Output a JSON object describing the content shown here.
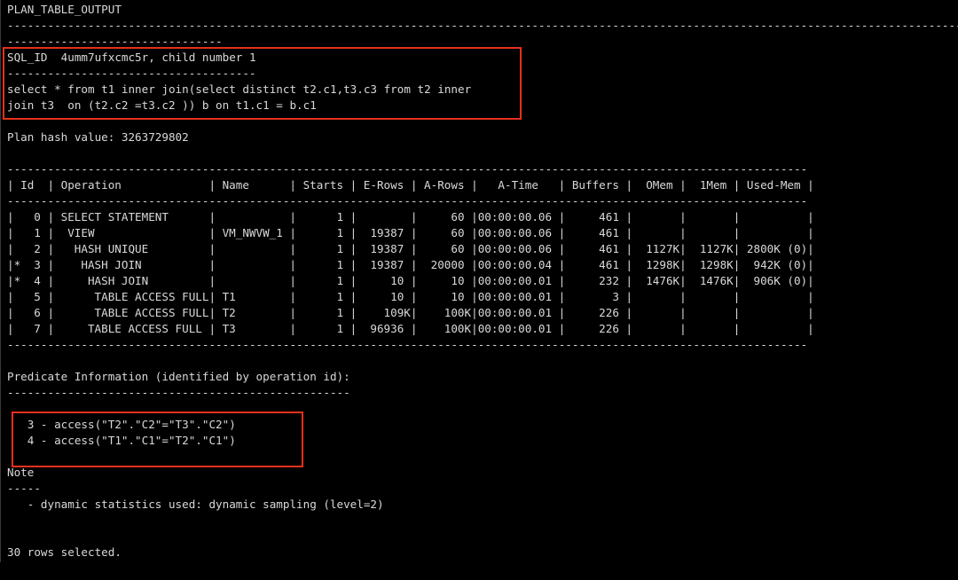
{
  "header_title": "PLAN_TABLE_OUTPUT",
  "separators": {
    "top_long": "----------------------------------------------------------------------------------------------------------------------------------------------",
    "top_short": "--------------------------------",
    "sql_id_under": "-------------------------------------",
    "table": "-----------------------------------------------------------------------------------------------------------------------",
    "predicate_under": "---------------------------------------------------",
    "note_under": "-----"
  },
  "sql": {
    "sql_id_line": "SQL_ID  4umm7ufxcmc5r, child number 1",
    "query_lines": [
      "select * from t1 inner join(select distinct t2.c1,t3.c3 from t2 inner",
      "join t3  on (t2.c2 =t3.c2 )) b on t1.c1 = b.c1"
    ]
  },
  "plan_hash": "Plan hash value: 3263729802",
  "table": {
    "columns": [
      "Id",
      "Operation",
      "Name",
      "Starts",
      "E-Rows",
      "A-Rows",
      "A-Time",
      "Buffers",
      "OMem",
      "1Mem",
      "Used-Mem"
    ],
    "rows": [
      {
        "flag": "",
        "id": "0",
        "depth": 0,
        "operation": "SELECT STATEMENT",
        "name": "",
        "starts": "1",
        "e_rows": "",
        "a_rows": "60",
        "a_time": "00:00:00.06",
        "buffers": "461",
        "omem": "",
        "onemem": "",
        "used_mem": ""
      },
      {
        "flag": "",
        "id": "1",
        "depth": 1,
        "operation": "VIEW",
        "name": "VM_NWVW_1",
        "starts": "1",
        "e_rows": "19387",
        "a_rows": "60",
        "a_time": "00:00:00.06",
        "buffers": "461",
        "omem": "",
        "onemem": "",
        "used_mem": ""
      },
      {
        "flag": "",
        "id": "2",
        "depth": 2,
        "operation": "HASH UNIQUE",
        "name": "",
        "starts": "1",
        "e_rows": "19387",
        "a_rows": "60",
        "a_time": "00:00:00.06",
        "buffers": "461",
        "omem": "1127K",
        "onemem": "1127K",
        "used_mem": "2800K (0)"
      },
      {
        "flag": "*",
        "id": "3",
        "depth": 3,
        "operation": "HASH JOIN",
        "name": "",
        "starts": "1",
        "e_rows": "19387",
        "a_rows": "20000",
        "a_time": "00:00:00.04",
        "buffers": "461",
        "omem": "1298K",
        "onemem": "1298K",
        "used_mem": "942K (0)"
      },
      {
        "flag": "*",
        "id": "4",
        "depth": 4,
        "operation": "HASH JOIN",
        "name": "",
        "starts": "1",
        "e_rows": "10",
        "a_rows": "10",
        "a_time": "00:00:00.01",
        "buffers": "232",
        "omem": "1476K",
        "onemem": "1476K",
        "used_mem": "906K (0)"
      },
      {
        "flag": "",
        "id": "5",
        "depth": 5,
        "operation": "TABLE ACCESS FULL",
        "name": "T1",
        "starts": "1",
        "e_rows": "10",
        "a_rows": "10",
        "a_time": "00:00:00.01",
        "buffers": "3",
        "omem": "",
        "onemem": "",
        "used_mem": ""
      },
      {
        "flag": "",
        "id": "6",
        "depth": 5,
        "operation": "TABLE ACCESS FULL",
        "name": "T2",
        "starts": "1",
        "e_rows": "109K",
        "a_rows": "100K",
        "a_time": "00:00:00.01",
        "buffers": "226",
        "omem": "",
        "onemem": "",
        "used_mem": ""
      },
      {
        "flag": "",
        "id": "7",
        "depth": 4,
        "operation": "TABLE ACCESS FULL",
        "name": "T3",
        "starts": "1",
        "e_rows": "96936",
        "a_rows": "100K",
        "a_time": "00:00:00.01",
        "buffers": "226",
        "omem": "",
        "onemem": "",
        "used_mem": ""
      }
    ]
  },
  "predicate": {
    "title": "Predicate Information (identified by operation id):",
    "items": [
      "   3 - access(\"T2\".\"C2\"=\"T3\".\"C2\")",
      "   4 - access(\"T1\".\"C1\"=\"T2\".\"C1\")"
    ]
  },
  "note": {
    "title": "Note",
    "items": [
      "   - dynamic statistics used: dynamic sampling (level=2)"
    ]
  },
  "footer": "30 rows selected.",
  "colors": {
    "background": "#000000",
    "text": "#d9d9d9",
    "highlight_box": "#e4301c"
  }
}
